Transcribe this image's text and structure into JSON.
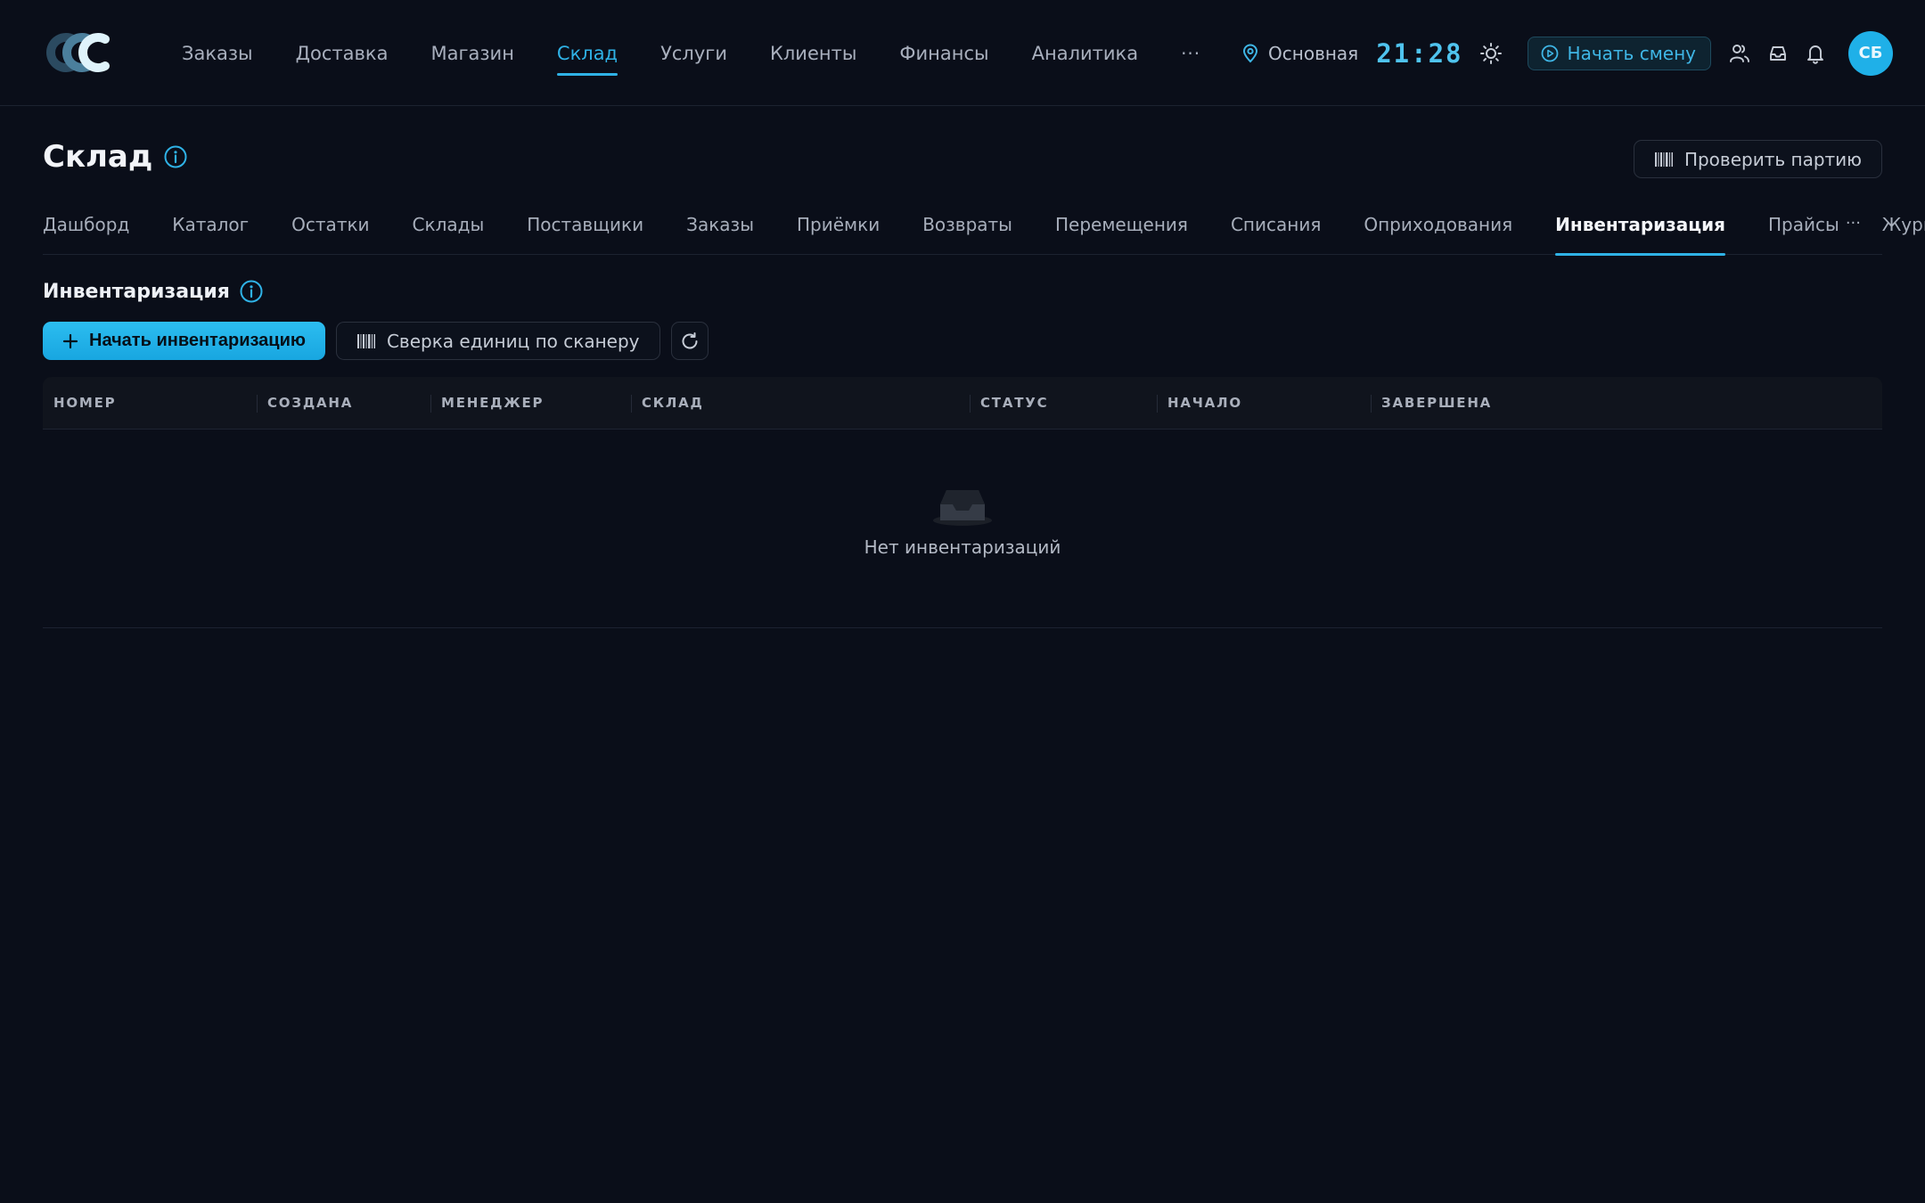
{
  "header": {
    "nav": [
      {
        "label": "Заказы",
        "active": false
      },
      {
        "label": "Доставка",
        "active": false
      },
      {
        "label": "Магазин",
        "active": false
      },
      {
        "label": "Склад",
        "active": true
      },
      {
        "label": "Услуги",
        "active": false
      },
      {
        "label": "Клиенты",
        "active": false
      },
      {
        "label": "Финансы",
        "active": false
      },
      {
        "label": "Аналитика",
        "active": false
      }
    ],
    "more_label": "···",
    "location": "Основная",
    "clock": "21:28",
    "shift_button": "Начать смену",
    "avatar_initials": "СБ"
  },
  "page": {
    "title": "Склад",
    "check_batch_button": "Проверить партию"
  },
  "subtabs": {
    "items": [
      {
        "label": "Дашборд",
        "active": false
      },
      {
        "label": "Каталог",
        "active": false
      },
      {
        "label": "Остатки",
        "active": false
      },
      {
        "label": "Склады",
        "active": false
      },
      {
        "label": "Поставщики",
        "active": false
      },
      {
        "label": "Заказы",
        "active": false
      },
      {
        "label": "Приёмки",
        "active": false
      },
      {
        "label": "Возвраты",
        "active": false
      },
      {
        "label": "Перемещения",
        "active": false
      },
      {
        "label": "Списания",
        "active": false
      },
      {
        "label": "Оприходования",
        "active": false
      },
      {
        "label": "Инвентаризация",
        "active": true
      },
      {
        "label": "Прайсы",
        "active": false
      },
      {
        "label": "Журнал",
        "active": false
      }
    ],
    "more_label": "···"
  },
  "section": {
    "title": "Инвентаризация",
    "start_button": "Начать инвентаризацию",
    "scanner_button": "Сверка единиц по сканеру"
  },
  "table": {
    "columns": [
      "НОМЕР",
      "СОЗДАНА",
      "МЕНЕДЖЕР",
      "СКЛАД",
      "СТАТУС",
      "НАЧАЛО",
      "ЗАВЕРШЕНА"
    ],
    "empty_text": "Нет инвентаризаций"
  },
  "colors": {
    "background": "#0a0e19",
    "accent": "#2fb2e6",
    "primary_button": "#1fb0e8"
  },
  "icons": {
    "logo": "ccc-logo",
    "location": "map-pin-icon",
    "theme": "sun-icon",
    "shift": "play-circle-icon",
    "users": "users-icon",
    "inbox": "inbox-icon",
    "bell": "bell-icon",
    "info": "info-icon",
    "barcode": "barcode-icon",
    "plus": "plus-icon",
    "refresh": "refresh-icon",
    "empty": "empty-inbox-icon"
  }
}
